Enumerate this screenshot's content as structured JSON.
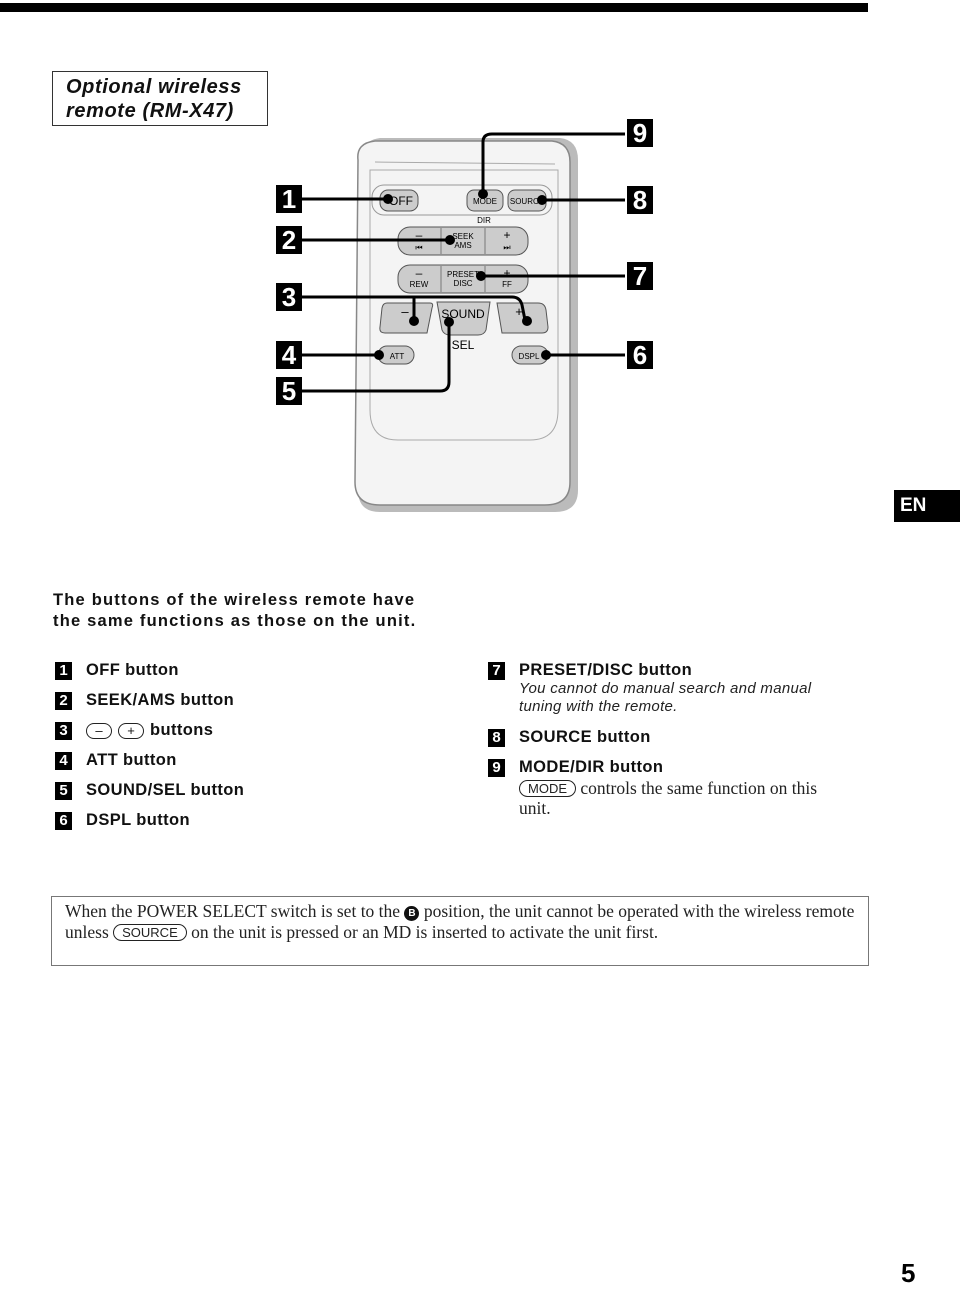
{
  "header": {
    "title_line1": "Optional wireless",
    "title_line2": "remote (RM-X47)"
  },
  "language_tab": "EN",
  "remote": {
    "buttons": {
      "off": "OFF",
      "mode": "MODE",
      "dir": "DIR",
      "source": "SOURCE",
      "seek_minus": "–",
      "seek_prev": "⏮",
      "seek_line1": "SEEK",
      "seek_line2": "AMS",
      "seek_plus": "+",
      "seek_next": "⏭",
      "rew_minus": "–",
      "rew": "REW",
      "preset_line1": "PRESET",
      "preset_line2": "DISC",
      "ff_plus": "+",
      "ff": "FF",
      "vol_minus": "–",
      "sound": "SOUND",
      "vol_plus": "+",
      "sel": "SEL",
      "att": "ATT",
      "dspl": "DSPL"
    },
    "callouts": [
      "1",
      "2",
      "3",
      "4",
      "5",
      "6",
      "7",
      "8",
      "9"
    ]
  },
  "intro": "The buttons of the wireless remote have the same functions as those on the unit.",
  "items": [
    {
      "num": "1",
      "label": "OFF button"
    },
    {
      "num": "2",
      "label": "SEEK/AMS button"
    },
    {
      "num": "3",
      "minus_key": "–",
      "plus_key": "+",
      "label": "buttons"
    },
    {
      "num": "4",
      "label": "ATT button"
    },
    {
      "num": "5",
      "label": "SOUND/SEL button"
    },
    {
      "num": "6",
      "label": "DSPL button"
    },
    {
      "num": "7",
      "label": "PRESET/DISC button",
      "note_line1": "You cannot do manual search and manual",
      "note_line2": "tuning with the remote."
    },
    {
      "num": "8",
      "label": "SOURCE button"
    },
    {
      "num": "9",
      "label": "MODE/DIR button",
      "key": "MODE",
      "desc_line1": "controls the same function on this",
      "desc_line2": "unit."
    }
  ],
  "notice": {
    "part1": "When the POWER SELECT switch is set to the",
    "badge": "B",
    "part2": "position, the unit cannot be operated with the wireless remote unless",
    "key": "SOURCE",
    "part3": "on the unit is pressed or an MD is inserted to activate the unit first."
  },
  "page_number": "5"
}
